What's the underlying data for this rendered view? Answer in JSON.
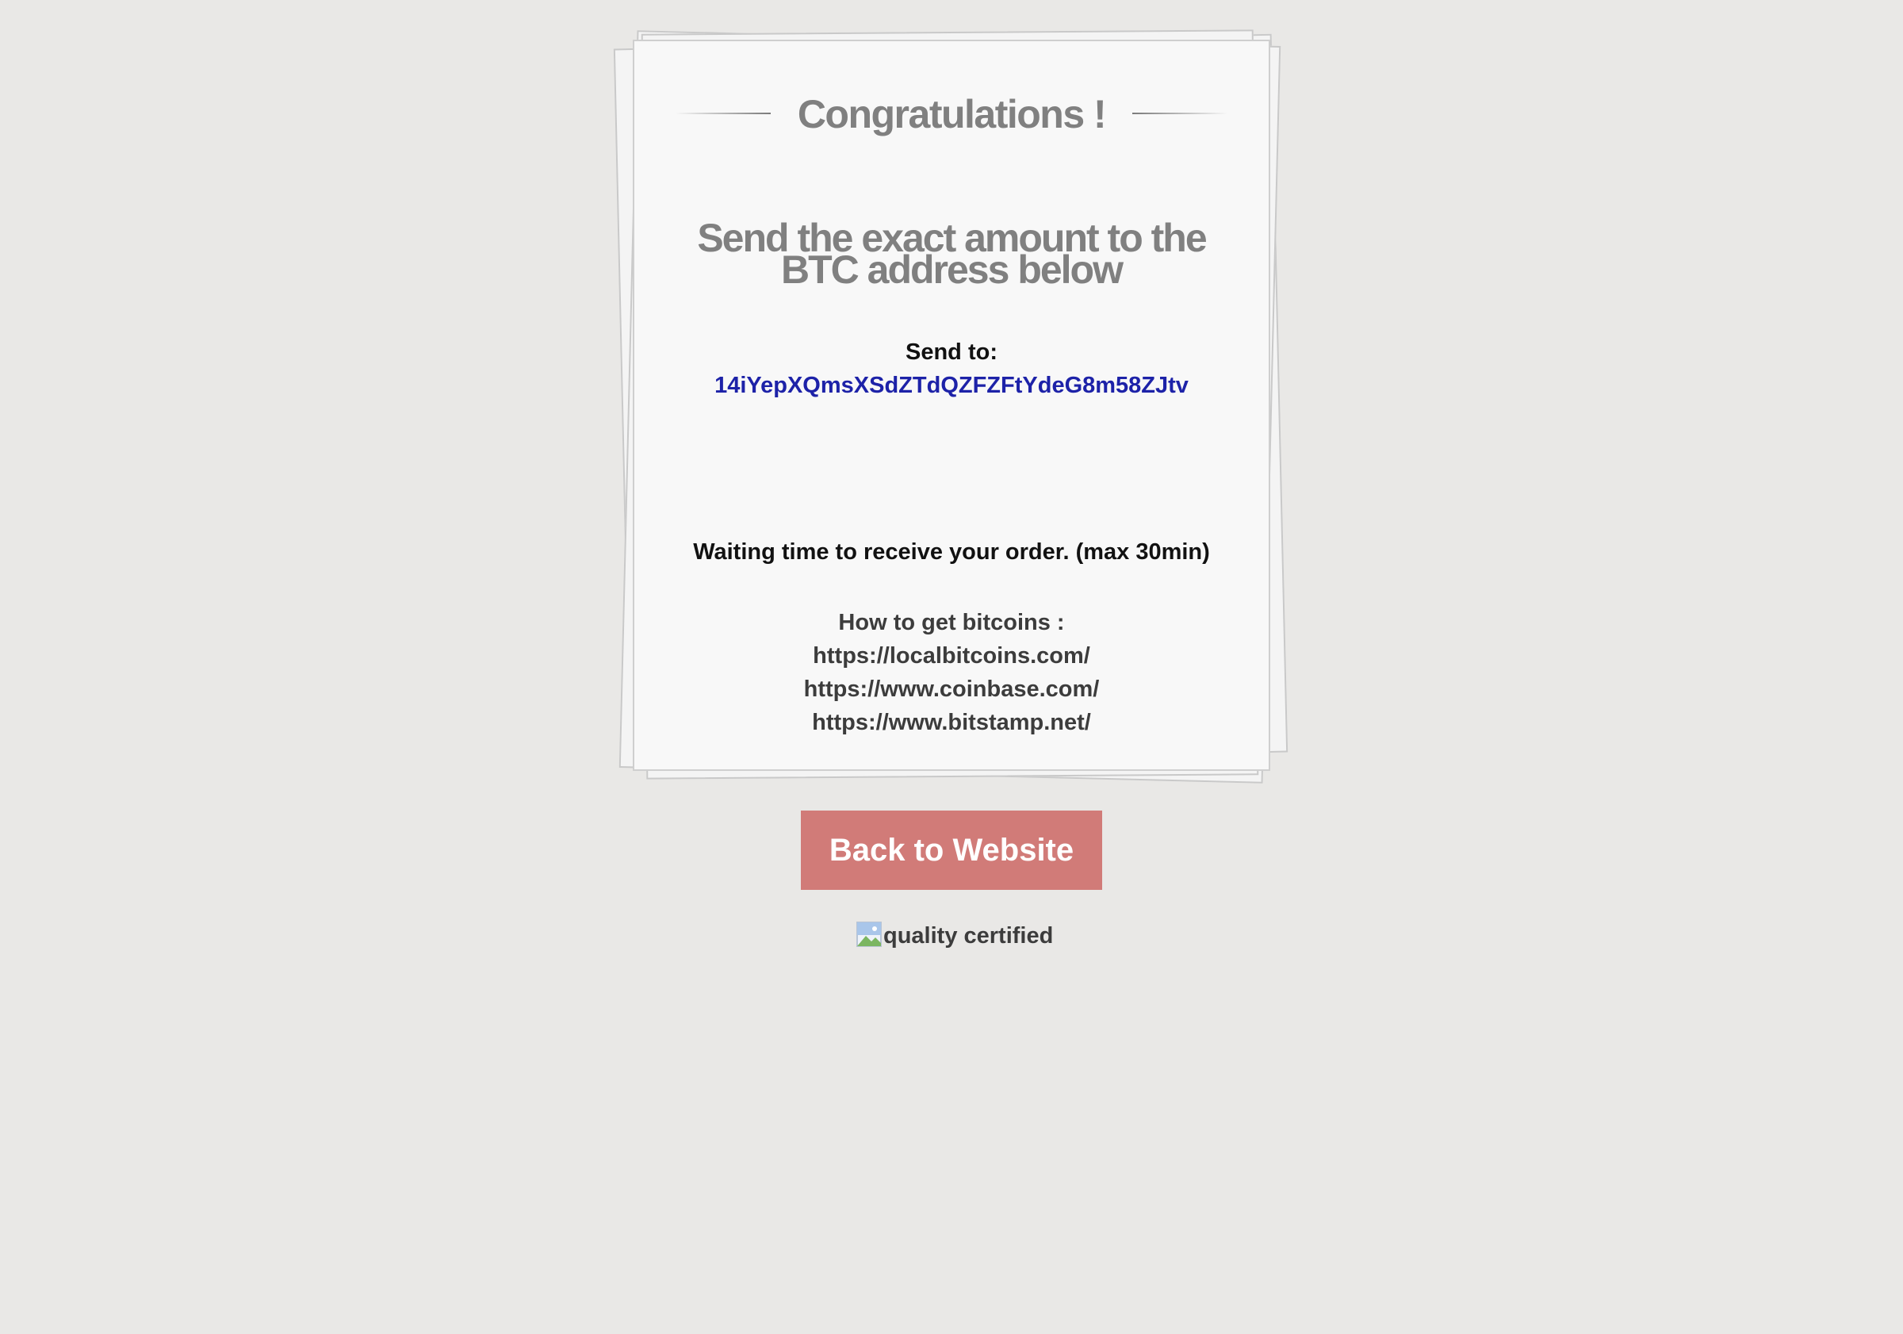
{
  "heading": "Congratulations !",
  "instruction": "Send the exact amount to the BTC address below",
  "send_to": {
    "label": "Send to:",
    "address": "14iYepXQmsXSdZTdQZFZFtYdeG8m58ZJtv"
  },
  "waiting_text": "Waiting time to receive your order. (max 30min)",
  "how_to": {
    "title": "How to get bitcoins :",
    "links": [
      "https://localbitcoins.com/",
      "https://www.coinbase.com/",
      "https://www.bitstamp.net/"
    ]
  },
  "back_button": "Back to Website",
  "badge_alt": "quality certified",
  "colors": {
    "background": "#e9e8e6",
    "card": "#f8f8f8",
    "heading": "#808080",
    "address": "#1d22a8",
    "button": "#d17b78"
  }
}
